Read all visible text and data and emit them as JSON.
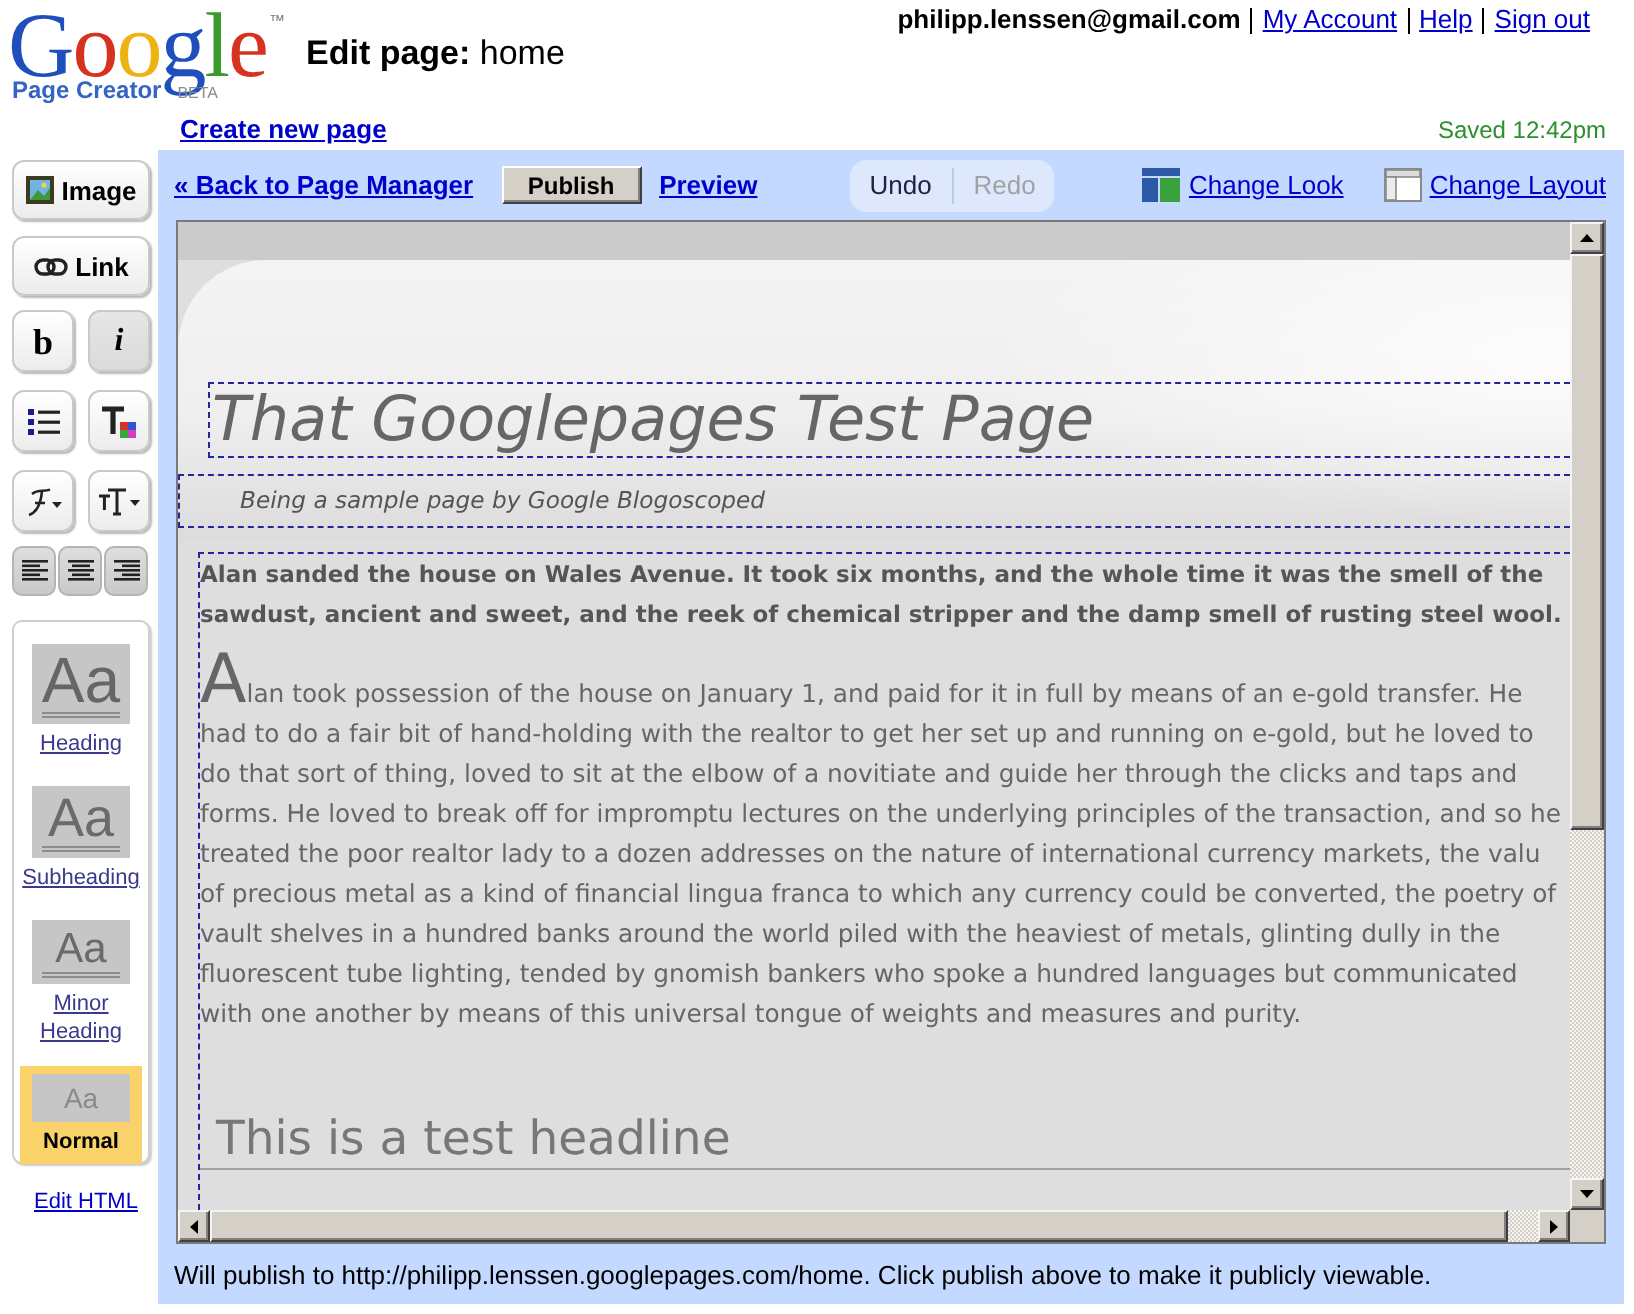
{
  "logo": {
    "wordmark": "Google",
    "trademark": "™",
    "product": "Page Creator",
    "badge": "BETA"
  },
  "page_title": "**Edit page:** home",
  "account": {
    "email": "philipp.lenssen@gmail.com",
    "links": [
      "My Account",
      "Help",
      "Sign out"
    ]
  },
  "create_link": "Create new page",
  "save_status": "Saved 12:42pm",
  "sidebar": {
    "insert_buttons": [
      {
        "kind": "image",
        "label": "Image"
      },
      {
        "kind": "link",
        "label": "Link"
      }
    ],
    "format_buttons": [
      {
        "kind": "bold",
        "label": "b",
        "on": false
      },
      {
        "kind": "italic",
        "label": "i",
        "on": true
      },
      {
        "kind": "list",
        "on": false
      },
      {
        "kind": "text-color"
      },
      {
        "kind": "font"
      },
      {
        "kind": "size"
      }
    ],
    "align_buttons": [
      {
        "kind": "left"
      },
      {
        "kind": "center"
      },
      {
        "kind": "right"
      }
    ],
    "styles": [
      {
        "kind": "heading",
        "sample": "Aa",
        "label": "Heading",
        "selected": false
      },
      {
        "kind": "subheading",
        "sample": "Aa",
        "label": "Subheading",
        "selected": false
      },
      {
        "kind": "minor",
        "sample": "Aa",
        "label": "Minor Heading",
        "selected": false
      },
      {
        "kind": "normal",
        "sample": "Aa",
        "label": "Normal",
        "selected": true
      }
    ],
    "edit_html": "Edit HTML"
  },
  "toolbar": {
    "back_link": "« Back to Page Manager",
    "publish_button": "Publish",
    "preview_link": "Preview",
    "history": [
      {
        "label": "Undo",
        "disabled": false
      },
      {
        "label": "Redo",
        "disabled": true
      }
    ],
    "look_links": [
      {
        "kind": "look",
        "label": "Change Look"
      },
      {
        "kind": "layout",
        "label": "Change Layout"
      }
    ]
  },
  "editor": {
    "title": "That Googlepages Test Page",
    "subtitle": "Being a sample page by Google Blogoscoped",
    "paragraphs": [
      {
        "kind": "lead",
        "lines": [
          "Alan sanded the house on Wales Avenue. It took six months, and the whole time it was the smell of the",
          "sawdust, ancient and sweet, and the reek of chemical stripper and the damp smell of rusting steel wool."
        ]
      },
      {
        "kind": "dropcap",
        "lines": [
          "Alan took possession of the house on January 1, and paid for it in full by means of an e-gold transfer. He",
          "had to do a fair bit of hand-holding with the realtor to get her set up and running on e-gold, but he loved to",
          "do that sort of thing, loved to sit at the elbow of a novitiate and guide her through the clicks and taps and",
          "forms. He loved to break off for impromptu lectures on the underlying principles of the transaction, and so he",
          "treated the poor realtor lady to a dozen addresses on the nature of international currency markets, the valu",
          "of precious metal as a kind of financial lingua franca to which any currency could be converted, the poetry of",
          "vault shelves in a hundred banks around the world piled with the heaviest of metals, glinting dully in the",
          "fluorescent tube lighting, tended by gnomish bankers who spoke a hundred languages but communicated",
          "with one another by means of this universal tongue of weights and measures and purity."
        ]
      }
    ],
    "headline": "This is a test headline"
  },
  "status_bar": "Will publish to http://philipp.lenssen.googlepages.com/home. Click publish above to make it publicly viewable."
}
